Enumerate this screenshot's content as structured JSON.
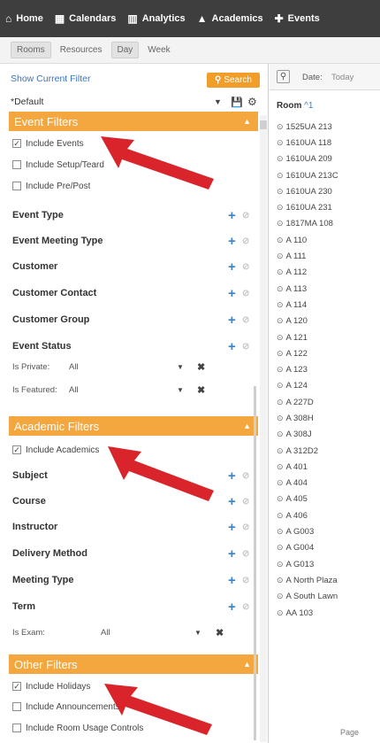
{
  "nav": {
    "items": [
      {
        "icon": "home-icon",
        "glyph": "⌂",
        "label": "Home"
      },
      {
        "icon": "calendar-icon",
        "glyph": "▦",
        "label": "Calendars"
      },
      {
        "icon": "analytics-icon",
        "glyph": "▥",
        "label": "Analytics"
      },
      {
        "icon": "academics-icon",
        "glyph": "▲",
        "label": "Academics"
      },
      {
        "icon": "events-icon",
        "glyph": "✚",
        "label": "Events"
      }
    ]
  },
  "subnav": {
    "tabs": [
      "Rooms",
      "Resources",
      "Day",
      "Week"
    ],
    "active": [
      "Rooms",
      "Day"
    ]
  },
  "left": {
    "show_filter": "Show Current Filter",
    "search_label": "Search",
    "default_label": "*Default",
    "event_filters": {
      "title": "Event Filters",
      "checks": [
        {
          "label": "Include Events",
          "checked": true
        },
        {
          "label": "Include Setup/Teard",
          "checked": false
        },
        {
          "label": "Include Pre/Post",
          "checked": false
        }
      ],
      "filters": [
        "Event Type",
        "Event Meeting Type",
        "Customer",
        "Customer Contact",
        "Customer Group",
        "Event Status"
      ],
      "selects": [
        {
          "label": "Is Private:",
          "value": "All"
        },
        {
          "label": "Is Featured:",
          "value": "All"
        }
      ]
    },
    "academic_filters": {
      "title": "Academic Filters",
      "checks": [
        {
          "label": "Include Academics",
          "checked": true
        }
      ],
      "filters": [
        "Subject",
        "Course",
        "Instructor",
        "Delivery Method",
        "Meeting Type",
        "Term"
      ],
      "selects": [
        {
          "label": "Is Exam:",
          "value": "All"
        }
      ]
    },
    "other_filters": {
      "title": "Other Filters",
      "checks": [
        {
          "label": "Include Holidays",
          "checked": true
        },
        {
          "label": "Include Announcements",
          "checked": false
        },
        {
          "label": "Include Room Usage Controls",
          "checked": false
        }
      ]
    }
  },
  "right": {
    "date_label": "Date:",
    "date_value": "Today",
    "room_header": "Room",
    "room_sort": "^1",
    "rooms": [
      "1525UA 213",
      "1610UA 118",
      "1610UA 209",
      "1610UA 213C",
      "1610UA 230",
      "1610UA 231",
      "1817MA 108",
      "A 110",
      "A 111",
      "A 112",
      "A 113",
      "A 114",
      "A 120",
      "A 121",
      "A 122",
      "A 123",
      "A 124",
      "A 227D",
      "A 308H",
      "A 308J",
      "A 312D2",
      "A 401",
      "A 404",
      "A 405",
      "A 406",
      "A G003",
      "A G004",
      "A G013",
      "A North Plaza",
      "A South Lawn",
      "AA 103"
    ],
    "page_label": "Page"
  },
  "colors": {
    "nav_bg": "#3e3e3e",
    "accent_orange": "#f4a73f",
    "link_blue": "#3a74b8",
    "arrow_red": "#d8242a"
  }
}
